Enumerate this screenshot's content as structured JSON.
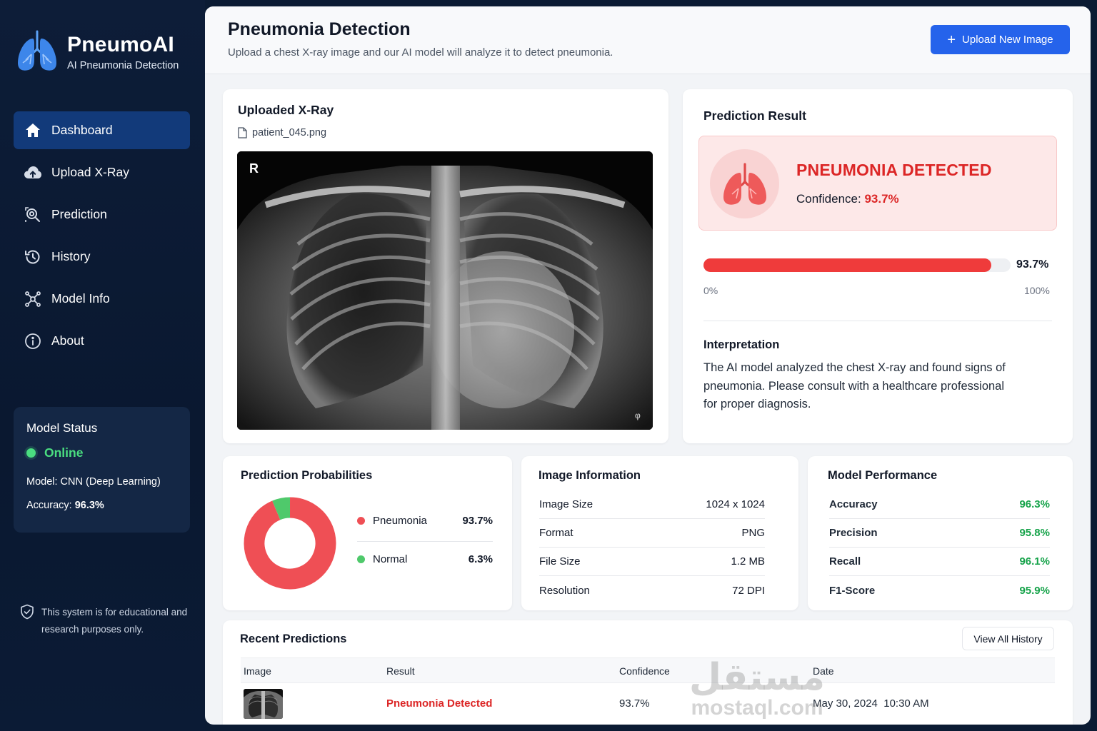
{
  "brand": {
    "title": "PneumoAI",
    "subtitle": "AI Pneumonia Detection"
  },
  "sidebar": {
    "items": [
      {
        "label": "Dashboard",
        "icon": "home-icon",
        "active": true
      },
      {
        "label": "Upload X-Ray",
        "icon": "cloud-upload-icon"
      },
      {
        "label": "Prediction",
        "icon": "search-scan-icon"
      },
      {
        "label": "History",
        "icon": "history-icon"
      },
      {
        "label": "Model Info",
        "icon": "network-icon"
      },
      {
        "label": "About",
        "icon": "info-icon"
      }
    ]
  },
  "model_status": {
    "title": "Model Status",
    "state": "Online",
    "model_label": "Model: CNN (Deep Learning)",
    "accuracy_label": "Accuracy:",
    "accuracy_value": "96.3%"
  },
  "disclaimer": "This system is for educational and research purposes only.",
  "header": {
    "title": "Pneumonia Detection",
    "subtitle": "Upload a chest X-ray image and our AI model will analyze it to detect pneumonia.",
    "upload_button": "Upload New Image"
  },
  "xray": {
    "title": "Uploaded X-Ray",
    "filename": "patient_045.png",
    "marker": "R"
  },
  "prediction": {
    "title": "Prediction Result",
    "result": "PNEUMONIA DETECTED",
    "confidence_label": "Confidence:",
    "confidence_value": "93.7%",
    "confidence_fraction": 0.937,
    "bar_min": "0%",
    "bar_max": "100%",
    "interpretation_title": "Interpretation",
    "interpretation_text": "The AI model analyzed the chest X-ray and found signs of pneumonia. Please consult with a healthcare professional for proper diagnosis."
  },
  "probabilities": {
    "title": "Prediction Probabilities",
    "items": [
      {
        "label": "Pneumonia",
        "value": "93.7%",
        "fraction": 0.937,
        "color": "#ef4f55"
      },
      {
        "label": "Normal",
        "value": "6.3%",
        "fraction": 0.063,
        "color": "#4fc96b"
      }
    ]
  },
  "image_info": {
    "title": "Image Information",
    "rows": [
      {
        "key": "Image Size",
        "value": "1024 x 1024"
      },
      {
        "key": "Format",
        "value": "PNG"
      },
      {
        "key": "File Size",
        "value": "1.2 MB"
      },
      {
        "key": "Resolution",
        "value": "72 DPI"
      }
    ]
  },
  "model_performance": {
    "title": "Model Performance",
    "rows": [
      {
        "key": "Accuracy",
        "value": "96.3%"
      },
      {
        "key": "Precision",
        "value": "95.8%"
      },
      {
        "key": "Recall",
        "value": "96.1%"
      },
      {
        "key": "F1-Score",
        "value": "95.9%"
      }
    ]
  },
  "recent": {
    "title": "Recent Predictions",
    "view_all": "View All History",
    "columns": [
      "Image",
      "Result",
      "Confidence",
      "Date"
    ],
    "rows": [
      {
        "result": "Pneumonia Detected",
        "confidence": "93.7%",
        "date": "May 30, 2024  10:30 AM"
      }
    ]
  },
  "watermark": {
    "arabic": "مستقل",
    "latin": "mostaql.com"
  },
  "colors": {
    "accent": "#2563eb",
    "danger": "#dc2626",
    "success": "#16a34a",
    "sidebar_bg": "#0d1d38"
  }
}
